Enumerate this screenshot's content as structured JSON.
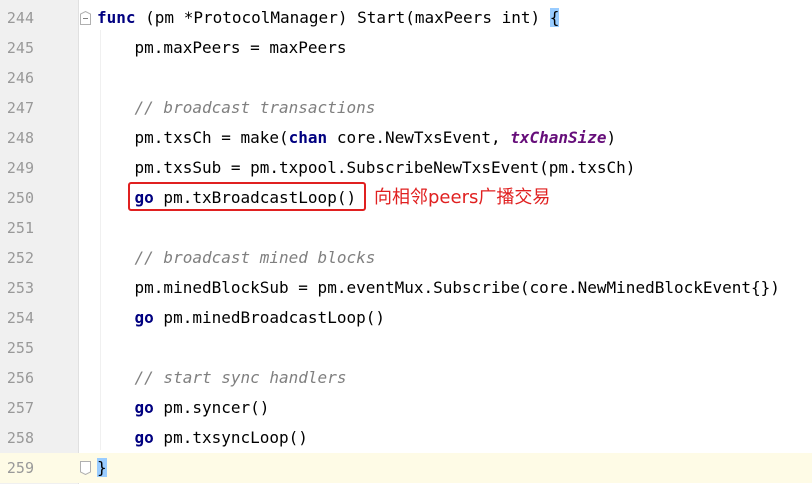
{
  "editor": {
    "lines": [
      {
        "n": "244"
      },
      {
        "n": "245"
      },
      {
        "n": "246"
      },
      {
        "n": "247"
      },
      {
        "n": "248"
      },
      {
        "n": "249"
      },
      {
        "n": "250"
      },
      {
        "n": "251"
      },
      {
        "n": "252"
      },
      {
        "n": "253"
      },
      {
        "n": "254"
      },
      {
        "n": "255"
      },
      {
        "n": "256"
      },
      {
        "n": "257"
      },
      {
        "n": "258"
      },
      {
        "n": "259"
      }
    ],
    "code": {
      "l244_func": "func",
      "l244_rest": " (pm *ProtocolManager) Start(maxPeers int) ",
      "l244_brace": "{",
      "l245": "    pm.maxPeers = maxPeers",
      "l247": "    // broadcast transactions",
      "l248_a": "    pm.txsCh = make(",
      "l248_chan": "chan",
      "l248_b": " core.NewTxsEvent, ",
      "l248_param": "txChanSize",
      "l248_c": ")",
      "l249": "    pm.txsSub = pm.txpool.SubscribeNewTxsEvent(pm.txsCh)",
      "l250_pad": "    ",
      "l250_go": "go",
      "l250_rest": " pm.txBroadcastLoop()",
      "l252": "    // broadcast mined blocks",
      "l253": "    pm.minedBlockSub = pm.eventMux.Subscribe(core.NewMinedBlockEvent{})",
      "l254_pad": "    ",
      "l254_go": "go",
      "l254_rest": " pm.minedBroadcastLoop()",
      "l256": "    // start sync handlers",
      "l257_pad": "    ",
      "l257_go": "go",
      "l257_rest": " pm.syncer()",
      "l258_pad": "    ",
      "l258_go": "go",
      "l258_rest": " pm.txsyncLoop()",
      "l259_brace": "}"
    },
    "annotation": "向相邻peers广播交易"
  },
  "colors": {
    "keyword": "#000080",
    "comment": "#808080",
    "param": "#660e7a",
    "annotation": "#e02020",
    "brace_match": "#99ccff",
    "caret_line": "#fefbe6"
  }
}
